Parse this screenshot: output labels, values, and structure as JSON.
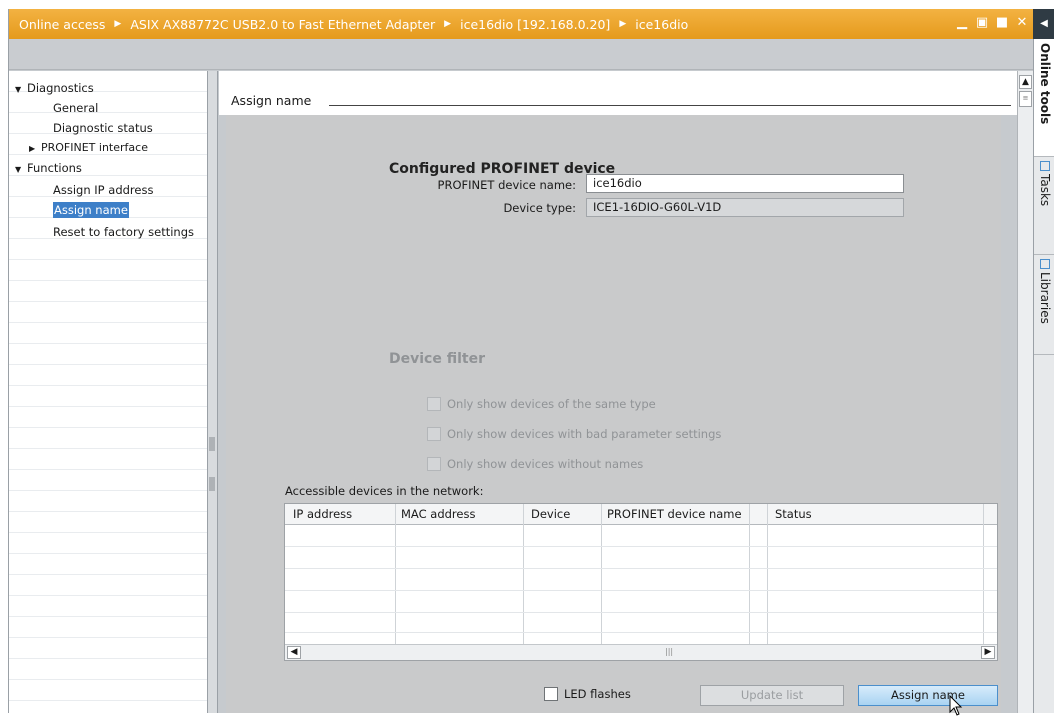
{
  "titlebar": {
    "crumbs": [
      "Online access",
      "ASIX AX88772C USB2.0 to Fast Ethernet Adapter",
      "ice16dio [192.168.0.20]",
      "ice16dio"
    ],
    "accent_color": "#e8a020"
  },
  "nav": {
    "items": [
      {
        "label": "Diagnostics"
      },
      {
        "label": "General"
      },
      {
        "label": "Diagnostic status"
      },
      {
        "label": "PROFINET interface"
      },
      {
        "label": "Functions"
      },
      {
        "label": "Assign IP address"
      },
      {
        "label": "Assign name"
      },
      {
        "label": "Reset to factory settings"
      }
    ],
    "selected": "Assign name"
  },
  "section": {
    "title": "Assign name"
  },
  "configured": {
    "heading": "Configured PROFINET device",
    "name_label": "PROFINET device name:",
    "name_value": "ice16dio",
    "type_label": "Device type:",
    "type_value": "ICE1-16DIO-G60L-V1D"
  },
  "filter": {
    "heading": "Device filter",
    "options": [
      "Only show devices of the same type",
      "Only show devices with bad parameter settings",
      "Only show devices without names"
    ]
  },
  "network": {
    "label": "Accessible devices in the network:",
    "columns": [
      "IP address",
      "MAC address",
      "Device",
      "PROFINET device name",
      "Status"
    ],
    "rows": []
  },
  "footer": {
    "led_label": "LED flashes",
    "update_label": "Update list",
    "assign_label": "Assign name"
  },
  "right_tabs": [
    "Online tools",
    "Tasks",
    "Libraries"
  ]
}
